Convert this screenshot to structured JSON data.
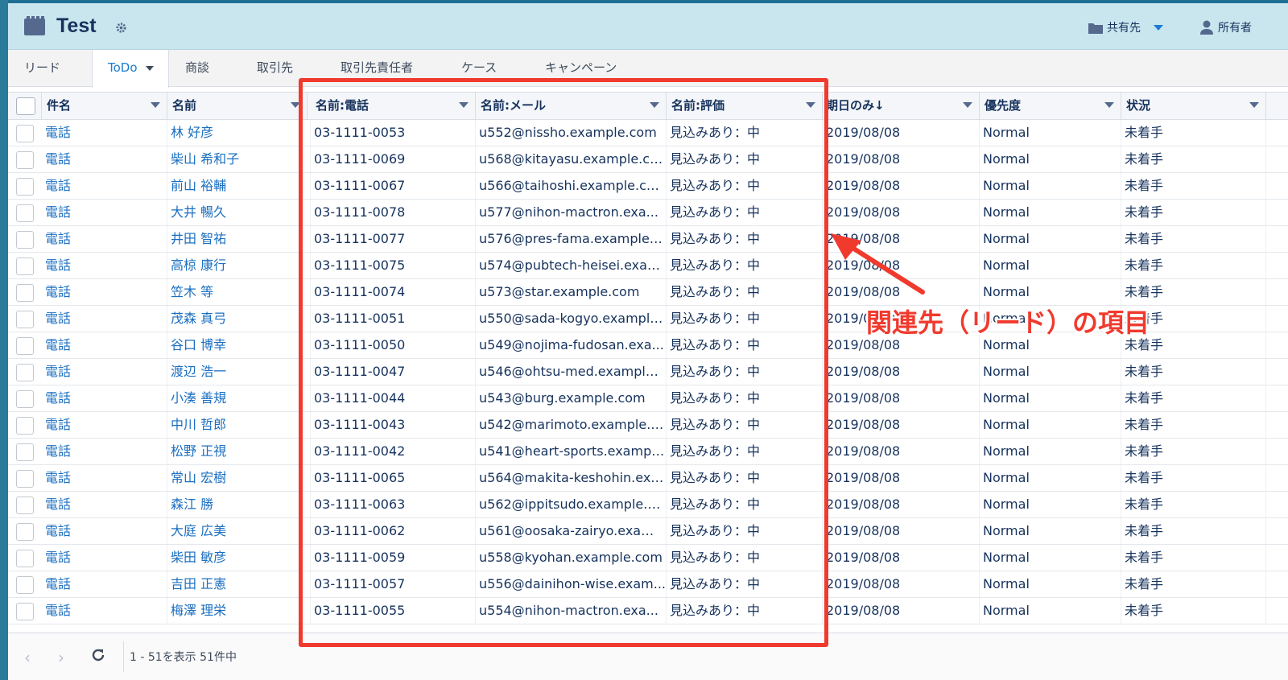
{
  "app": {
    "title": "Test"
  },
  "header": {
    "share_label": "共有先",
    "owner_label": "所有者"
  },
  "tabs": [
    {
      "label": "リード"
    },
    {
      "label": "ToDo",
      "active": true
    },
    {
      "label": "商談"
    },
    {
      "label": "取引先"
    },
    {
      "label": "取引先責任者"
    },
    {
      "label": "ケース"
    },
    {
      "label": "キャンペーン"
    }
  ],
  "table": {
    "columns": [
      "件名",
      "名前",
      "名前:電話",
      "名前:メール",
      "名前:評価",
      "期日のみ↓",
      "優先度",
      "状況"
    ],
    "rows": [
      {
        "subject": "電話",
        "name": "林 好彦",
        "phone": "03-1111-0053",
        "email": "u552@nissho.example.com",
        "rating": "見込みあり：中",
        "due": "2019/08/08",
        "priority": "Normal",
        "status": "未着手"
      },
      {
        "subject": "電話",
        "name": "柴山 希和子",
        "phone": "03-1111-0069",
        "email": "u568@kitayasu.example.com",
        "rating": "見込みあり：中",
        "due": "2019/08/08",
        "priority": "Normal",
        "status": "未着手"
      },
      {
        "subject": "電話",
        "name": "前山 裕輔",
        "phone": "03-1111-0067",
        "email": "u566@taihoshi.example.com",
        "rating": "見込みあり：中",
        "due": "2019/08/08",
        "priority": "Normal",
        "status": "未着手"
      },
      {
        "subject": "電話",
        "name": "大井 暢久",
        "phone": "03-1111-0078",
        "email": "u577@nihon-mactron.exa...",
        "rating": "見込みあり：中",
        "due": "2019/08/08",
        "priority": "Normal",
        "status": "未着手"
      },
      {
        "subject": "電話",
        "name": "井田 智祐",
        "phone": "03-1111-0077",
        "email": "u576@pres-fama.example.c...",
        "rating": "見込みあり：中",
        "due": "2019/08/08",
        "priority": "Normal",
        "status": "未着手"
      },
      {
        "subject": "電話",
        "name": "高椋 康行",
        "phone": "03-1111-0075",
        "email": "u574@pubtech-heisei.exam...",
        "rating": "見込みあり：中",
        "due": "2019/08/08",
        "priority": "Normal",
        "status": "未着手"
      },
      {
        "subject": "電話",
        "name": "笠木 等",
        "phone": "03-1111-0074",
        "email": "u573@star.example.com",
        "rating": "見込みあり：中",
        "due": "2019/08/08",
        "priority": "Normal",
        "status": "未着手"
      },
      {
        "subject": "電話",
        "name": "茂森 真弓",
        "phone": "03-1111-0051",
        "email": "u550@sada-kogyo.example...",
        "rating": "見込みあり：中",
        "due": "2019/08/08",
        "priority": "Normal",
        "status": "未着手"
      },
      {
        "subject": "電話",
        "name": "谷口 博幸",
        "phone": "03-1111-0050",
        "email": "u549@nojima-fudosan.exa...",
        "rating": "見込みあり：中",
        "due": "2019/08/08",
        "priority": "Normal",
        "status": "未着手"
      },
      {
        "subject": "電話",
        "name": "渡辺 浩一",
        "phone": "03-1111-0047",
        "email": "u546@ohtsu-med.example....",
        "rating": "見込みあり：中",
        "due": "2019/08/08",
        "priority": "Normal",
        "status": "未着手"
      },
      {
        "subject": "電話",
        "name": "小湊 善規",
        "phone": "03-1111-0044",
        "email": "u543@burg.example.com",
        "rating": "見込みあり：中",
        "due": "2019/08/08",
        "priority": "Normal",
        "status": "未着手"
      },
      {
        "subject": "電話",
        "name": "中川 哲郎",
        "phone": "03-1111-0043",
        "email": "u542@marimoto.example.c...",
        "rating": "見込みあり：中",
        "due": "2019/08/08",
        "priority": "Normal",
        "status": "未着手"
      },
      {
        "subject": "電話",
        "name": "松野 正視",
        "phone": "03-1111-0042",
        "email": "u541@heart-sports.exampl...",
        "rating": "見込みあり：中",
        "due": "2019/08/08",
        "priority": "Normal",
        "status": "未着手"
      },
      {
        "subject": "電話",
        "name": "常山 宏樹",
        "phone": "03-1111-0065",
        "email": "u564@makita-keshohin.exa...",
        "rating": "見込みあり：中",
        "due": "2019/08/08",
        "priority": "Normal",
        "status": "未着手"
      },
      {
        "subject": "電話",
        "name": "森江 勝",
        "phone": "03-1111-0063",
        "email": "u562@ippitsudo.example.c...",
        "rating": "見込みあり：中",
        "due": "2019/08/08",
        "priority": "Normal",
        "status": "未着手"
      },
      {
        "subject": "電話",
        "name": "大庭 広美",
        "phone": "03-1111-0062",
        "email": "u561@oosaka-zairyo.examp...",
        "rating": "見込みあり：中",
        "due": "2019/08/08",
        "priority": "Normal",
        "status": "未着手"
      },
      {
        "subject": "電話",
        "name": "柴田 敏彦",
        "phone": "03-1111-0059",
        "email": "u558@kyohan.example.com",
        "rating": "見込みあり：中",
        "due": "2019/08/08",
        "priority": "Normal",
        "status": "未着手"
      },
      {
        "subject": "電話",
        "name": "吉田 正憲",
        "phone": "03-1111-0057",
        "email": "u556@dainihon-wise.exam...",
        "rating": "見込みあり：中",
        "due": "2019/08/08",
        "priority": "Normal",
        "status": "未着手"
      },
      {
        "subject": "電話",
        "name": "梅澤 理栄",
        "phone": "03-1111-0055",
        "email": "u554@nihon-mactron.exa...",
        "rating": "見込みあり：中",
        "due": "2019/08/08",
        "priority": "Normal",
        "status": "未着手"
      }
    ]
  },
  "footer": {
    "record_count": "1 - 51を表示 51件中"
  },
  "annotation": {
    "text": "関連先（リード）の項目"
  },
  "colors": {
    "header_bg": "#c9e6ef",
    "link": "#1b6fc1",
    "accent": "#1b7dd1",
    "annotation": "#f03a2e"
  }
}
